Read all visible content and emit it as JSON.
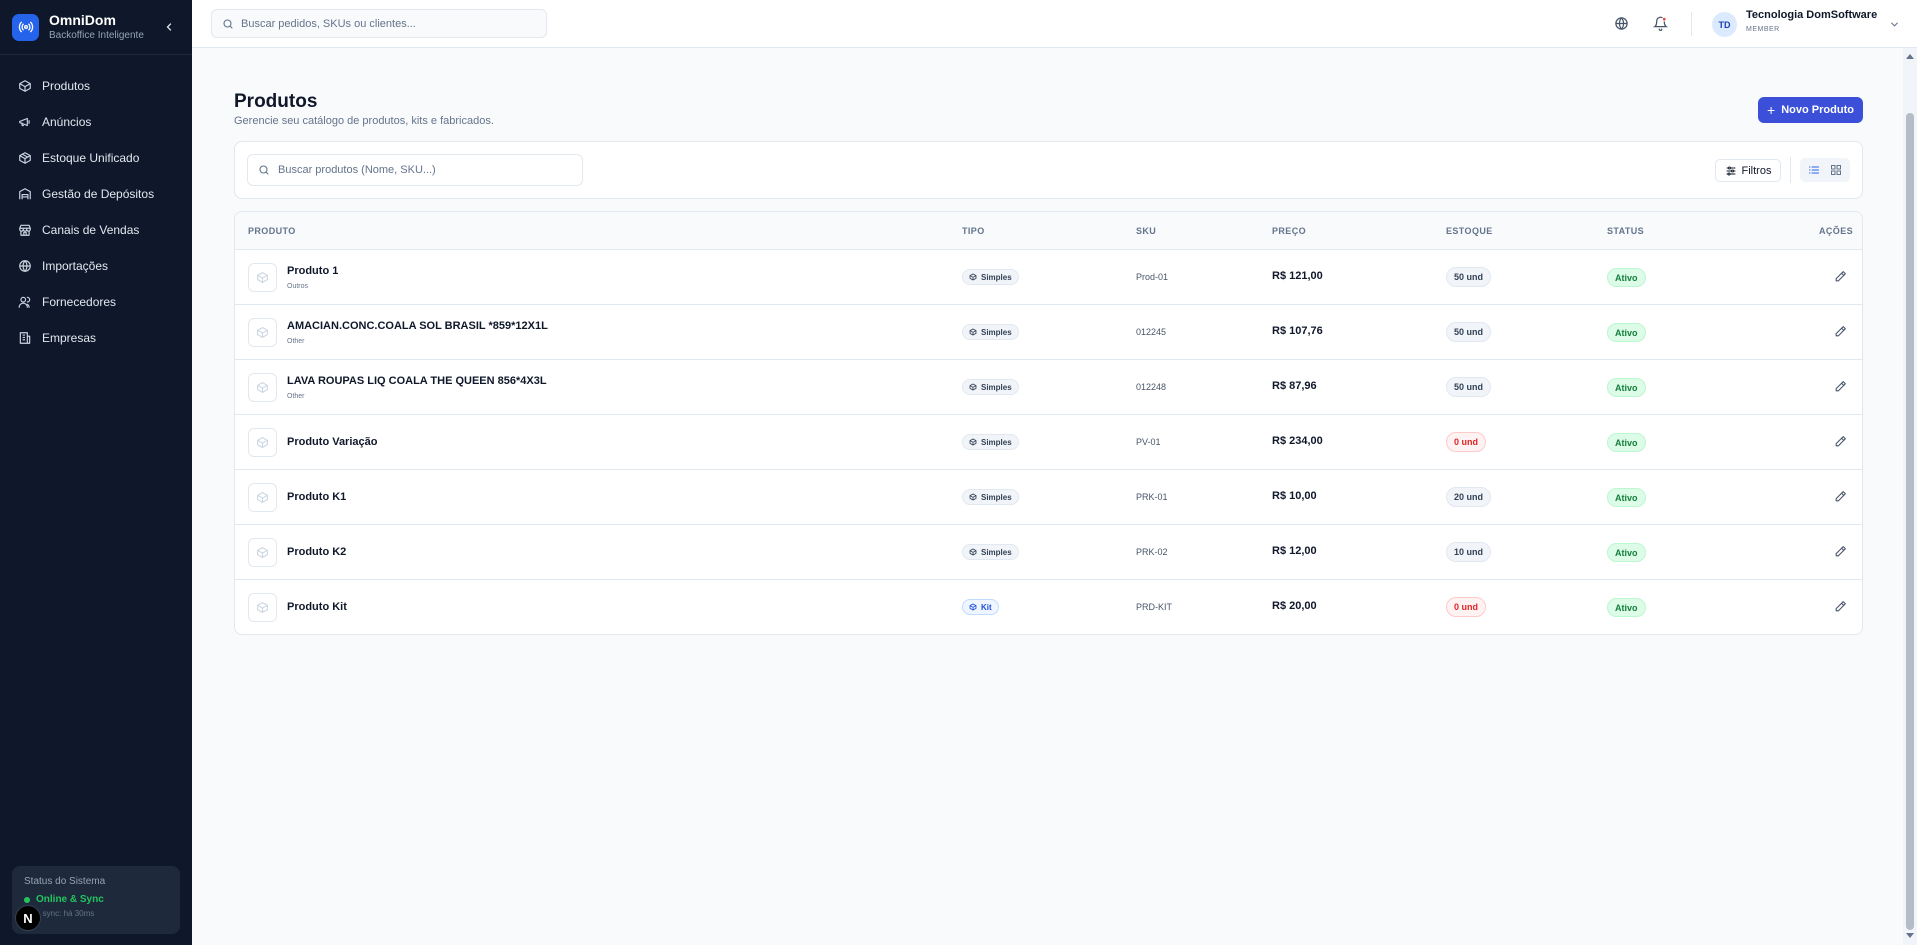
{
  "brand": {
    "name": "OmniDom",
    "subtitle": "Backoffice Inteligente"
  },
  "sidebar": {
    "items": [
      {
        "label": "Produtos",
        "icon": "box-icon"
      },
      {
        "label": "Anúncios",
        "icon": "megaphone-icon"
      },
      {
        "label": "Estoque Unificado",
        "icon": "package-icon"
      },
      {
        "label": "Gestão de Depósitos",
        "icon": "warehouse-icon"
      },
      {
        "label": "Canais de Vendas",
        "icon": "store-icon"
      },
      {
        "label": "Importações",
        "icon": "globe-icon"
      },
      {
        "label": "Fornecedores",
        "icon": "users-icon"
      },
      {
        "label": "Empresas",
        "icon": "building-icon"
      }
    ],
    "status": {
      "title": "Status do Sistema",
      "state": "Online & Sync",
      "sync": "a sync: há 30ms"
    },
    "badge": "N"
  },
  "header": {
    "search_placeholder": "Buscar pedidos, SKUs ou clientes...",
    "user": {
      "initials": "TD",
      "name": "Tecnologia DomSoftware",
      "role": "MEMBER"
    }
  },
  "page": {
    "title": "Produtos",
    "subtitle": "Gerencie seu catálogo de produtos, kits e fabricados.",
    "new_button": "Novo Produto",
    "search_placeholder": "Buscar produtos (Nome, SKU...)",
    "filters_label": "Filtros"
  },
  "table": {
    "columns": {
      "produto": "PRODUTO",
      "tipo": "TIPO",
      "sku": "SKU",
      "preco": "PREÇO",
      "estoque": "ESTOQUE",
      "status": "STATUS",
      "acoes": "AÇÕES"
    },
    "rows": [
      {
        "name": "Produto 1",
        "category": "Outros",
        "tipo": "Simples",
        "sku": "Prod-01",
        "preco": "R$ 121,00",
        "estoque": "50 und",
        "status": "Ativo"
      },
      {
        "name": "AMACIAN.CONC.COALA SOL BRASIL *859*12X1L",
        "category": "Other",
        "tipo": "Simples",
        "sku": "012245",
        "preco": "R$ 107,76",
        "estoque": "50 und",
        "status": "Ativo"
      },
      {
        "name": "LAVA ROUPAS LIQ COALA THE QUEEN 856*4X3L",
        "category": "Other",
        "tipo": "Simples",
        "sku": "012248",
        "preco": "R$ 87,96",
        "estoque": "50 und",
        "status": "Ativo"
      },
      {
        "name": "Produto Variação",
        "category": "",
        "tipo": "Simples",
        "sku": "PV-01",
        "preco": "R$ 234,00",
        "estoque": "0 und",
        "status": "Ativo"
      },
      {
        "name": "Produto K1",
        "category": "",
        "tipo": "Simples",
        "sku": "PRK-01",
        "preco": "R$ 10,00",
        "estoque": "20 und",
        "status": "Ativo"
      },
      {
        "name": "Produto K2",
        "category": "",
        "tipo": "Simples",
        "sku": "PRK-02",
        "preco": "R$ 12,00",
        "estoque": "10 und",
        "status": "Ativo"
      },
      {
        "name": "Produto Kit",
        "category": "",
        "tipo": "Kit",
        "sku": "PRD-KIT",
        "preco": "R$ 20,00",
        "estoque": "0 und",
        "status": "Ativo"
      }
    ]
  },
  "colors": {
    "sidebar_bg": "#0f172a",
    "accent": "#3b4fd8",
    "active_green": "#15803d",
    "zero_red": "#dc2626"
  }
}
